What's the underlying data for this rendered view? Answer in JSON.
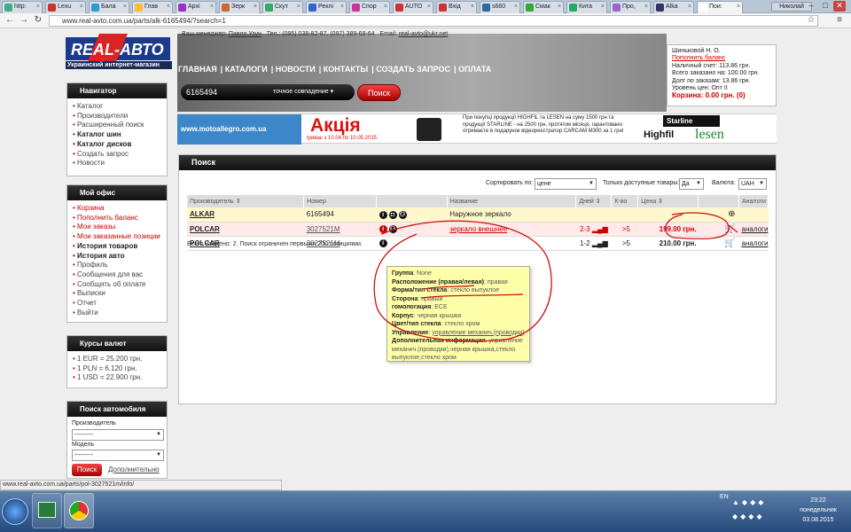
{
  "browser": {
    "tabs": [
      "http:",
      "Lexu",
      "Бала",
      "Глав",
      "Архі",
      "Зерк",
      "Скут",
      "Реклі",
      "Спор",
      "AUTO",
      "Вхід",
      "s660",
      "Смак",
      "Кита",
      "Про,",
      "Alka",
      "Пои:"
    ],
    "active_tab_index": 16,
    "user": "Николай",
    "url": "www.real-avto.com.ua/parts/alk-6165494/?search=1"
  },
  "site": {
    "logo_text": "REAL-АВТО",
    "tagline": "Украинский интернет-магазин",
    "top_info": {
      "manager_label": "Ваш менеджер:",
      "manager": "Павло Узун",
      "phone_label": "Тел.:",
      "phones": "(095) 038-82-87, (097) 389-68-64",
      "email_label": "Email:",
      "email": "real-avto@ukr.net"
    },
    "nav": [
      "ГЛАВНАЯ",
      "КАТАЛОГИ",
      "НОВОСТИ",
      "КОНТАКТЫ",
      "СОЗДАТЬ ЗАПРОС",
      "ОПЛАТА"
    ]
  },
  "account": {
    "name": "Шиньковой Н. О.",
    "topup": "Пополнить баланс",
    "cash": "Наличный счет: 113.86 грн.",
    "ordered": "Всего заказано на: 100.00 грн.",
    "debt": "Долг по заказам: 13.86 грн.",
    "level": "Уровень цен: Опт II",
    "cart": "Корзина: 0.00 грн. (0)"
  },
  "search": {
    "query": "6165494",
    "mode": "точное совпадение",
    "button": "Поиск"
  },
  "promo": {
    "site": "www.motoallegro.com.ua",
    "akcia": "Акція",
    "dates": "триває з 10.04 по 10.05.2015",
    "text": "При покупці продукції HIGHFIL та LESEN на суму 1500 грн та продукції STARLINE - на 2500 грн, протягом місяця, гарантовано отримаєте в подарунок відеореєстратор CARCAM M300 за 1 грн!",
    "brands": [
      "Starline",
      "Highfil",
      "lesen"
    ]
  },
  "sidebar": {
    "navigator": {
      "title": "Навигатор",
      "items": [
        "Каталог",
        "Производители",
        "Расширенный поиск",
        "Каталог шин",
        "Каталог дисков",
        "Создать запрос",
        "Новости"
      ]
    },
    "office": {
      "title": "Мой офис",
      "items": [
        "Корзина",
        "Пополнить баланс",
        "Мои заказы",
        "Мои заказанные позиции",
        "История товаров",
        "История авто",
        "Профиль",
        "Сообщения для вас",
        "Сообщить об оплате",
        "Выписки",
        "Отчет",
        "Выйти"
      ]
    },
    "rates": {
      "title": "Курсы валют",
      "items": [
        "1 EUR = 25.200 грн.",
        "1 PLN = 6.120 грн.",
        "1 USD = 22.900 грн."
      ]
    },
    "carsearch": {
      "title": "Поиск автомобиля",
      "maker_label": "Производитель",
      "maker_value": "---------",
      "model_label": "Модель",
      "model_value": "---------",
      "button": "Поиск",
      "advanced": "Дополнительно"
    }
  },
  "results": {
    "title": "Поиск",
    "sort_label": "Сортировать по:",
    "sort_value": "цене",
    "avail_label": "Только доступные товары:",
    "avail_value": "Да",
    "currency_label": "Валюта:",
    "currency_value": "UAH",
    "columns": [
      "Производитель",
      "Номер",
      "",
      "Название",
      "Дней",
      "К-во",
      "Цена",
      "",
      "Аналоги"
    ],
    "rows": [
      {
        "maker": "ALKAR",
        "number": "6165494",
        "name": "Наружное зеркало",
        "days": "",
        "qty": "",
        "price": "",
        "analogs": ""
      },
      {
        "maker": "POLCAR",
        "number": "3027521M",
        "name": "зеркало внешнее",
        "days": "2-3",
        "qty": ">5",
        "price": "199.00 грн.",
        "analogs": "аналоги"
      },
      {
        "maker": "POLCAR",
        "number": "3027521M",
        "name": "",
        "days": "1-2",
        "qty": ">5",
        "price": "210.00 грн.",
        "analogs": "аналоги"
      }
    ],
    "found": "Всего найдено: 2. Поиск ограничен первыми 200 позициями."
  },
  "tooltip": [
    {
      "k": "Группа",
      "v": "None"
    },
    {
      "k": "Расположение (правая/левая)",
      "v": "правая"
    },
    {
      "k": "Форма/тип стекла",
      "v": "стекло выпуклое"
    },
    {
      "k": "Сторона",
      "v": "правый"
    },
    {
      "k": "гомологация",
      "v": "ECE"
    },
    {
      "k": "Корпус",
      "v": "черная крышка"
    },
    {
      "k": "Цвет/тип стекла",
      "v": "стекло хром"
    },
    {
      "k": "Управление",
      "v": "управление механич.(проводки)"
    },
    {
      "k": "Дополнительная информация",
      "v": "управление механич.(проводки),черная крышка,стекло выпуклое,стекло хром"
    }
  ],
  "status_url": "www.real-avto.com.ua/parts/pol-3027521m/info/",
  "taskbar": {
    "lang": "EN",
    "time": "23:22",
    "day": "понедельник",
    "date": "03.08.2015"
  },
  "colors": {
    "accent": "#cc0000",
    "annotation": "#d01010",
    "highlight_row": "#fff8cc"
  }
}
